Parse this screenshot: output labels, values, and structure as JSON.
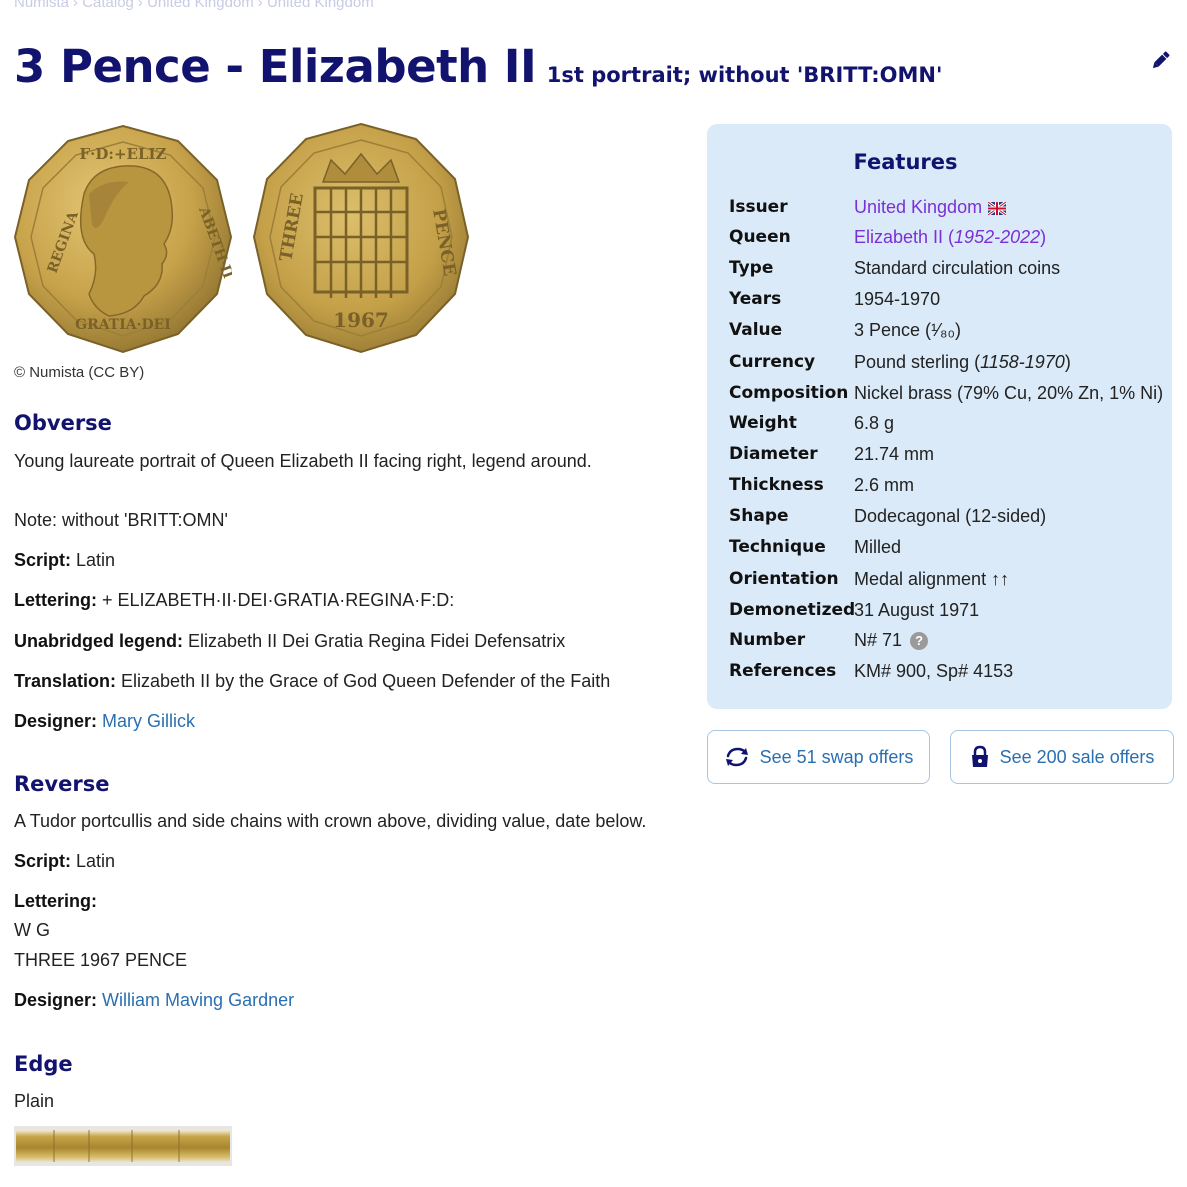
{
  "breadcrumb": [
    "Numista",
    "Catalog",
    "United Kingdom",
    "United Kingdom"
  ],
  "title": {
    "main": "3 Pence - Elizabeth II",
    "sub": "1st portrait; without 'BRITT:OMN'"
  },
  "image_credit": "© Numista (CC BY)",
  "obverse": {
    "heading": "Obverse",
    "description": "Young laureate portrait of Queen Elizabeth II facing right, legend around.",
    "note": "Note: without 'BRITT:OMN'",
    "script_label": "Script:",
    "script_value": "Latin",
    "lettering_label": "Lettering:",
    "lettering_value": "+ ELIZABETH·II·DEI·GRATIA·REGINA·F:D:",
    "unabridged_label": "Unabridged legend:",
    "unabridged_value": "Elizabeth II Dei Gratia Regina Fidei Defensatrix",
    "translation_label": "Translation:",
    "translation_value": "Elizabeth II by the Grace of God Queen Defender of the Faith",
    "designer_label": "Designer:",
    "designer_value": "Mary Gillick"
  },
  "reverse": {
    "heading": "Reverse",
    "description": "A Tudor portcullis and side chains with crown above, dividing value, date below.",
    "script_label": "Script:",
    "script_value": "Latin",
    "lettering_label": "Lettering:",
    "lettering_line1": "W G",
    "lettering_line2": "THREE 1967 PENCE",
    "designer_label": "Designer:",
    "designer_value": "William Maving Gardner"
  },
  "edge": {
    "heading": "Edge",
    "value": "Plain"
  },
  "features": {
    "title": "Features",
    "issuer": {
      "label": "Issuer",
      "value": "United Kingdom"
    },
    "queen": {
      "label": "Queen",
      "name": "Elizabeth II (",
      "years": "1952-2022",
      "close": ")"
    },
    "type": {
      "label": "Type",
      "value": "Standard circulation coins"
    },
    "years": {
      "label": "Years",
      "value": "1954-1970"
    },
    "value": {
      "label": "Value",
      "value": "3 Pence (¹⁄₈₀)"
    },
    "currency": {
      "label": "Currency",
      "name": "Pound sterling (",
      "years": "1158-1970",
      "close": ")"
    },
    "composition": {
      "label": "Composition",
      "value": "Nickel brass (79% Cu, 20% Zn, 1% Ni)"
    },
    "weight": {
      "label": "Weight",
      "value": "6.8 g"
    },
    "diameter": {
      "label": "Diameter",
      "value": "21.74 mm"
    },
    "thickness": {
      "label": "Thickness",
      "value": "2.6 mm"
    },
    "shape": {
      "label": "Shape",
      "value": "Dodecagonal (12-sided)"
    },
    "technique": {
      "label": "Technique",
      "value": "Milled"
    },
    "orientation": {
      "label": "Orientation",
      "value": "Medal alignment ↑↑"
    },
    "demonetized": {
      "label": "Demonetized",
      "value": "31 August 1971"
    },
    "number": {
      "label": "Number",
      "value": "N# 71"
    },
    "references": {
      "label": "References",
      "value": "KM# 900, Sp# 4153"
    }
  },
  "offers": {
    "swap_label": "See 51 swap offers",
    "sale_label": "See 200 sale offers"
  },
  "colors": {
    "heading": "#12136e",
    "link": "#2a6fb0",
    "purple_link": "#7b2fd6",
    "panel_bg": "#dbeaf8",
    "coin": "#c9a94e"
  },
  "icons": [
    "edit-pen-icon",
    "uk-flag-icon",
    "help-icon",
    "swap-icon",
    "lock-bag-icon"
  ]
}
